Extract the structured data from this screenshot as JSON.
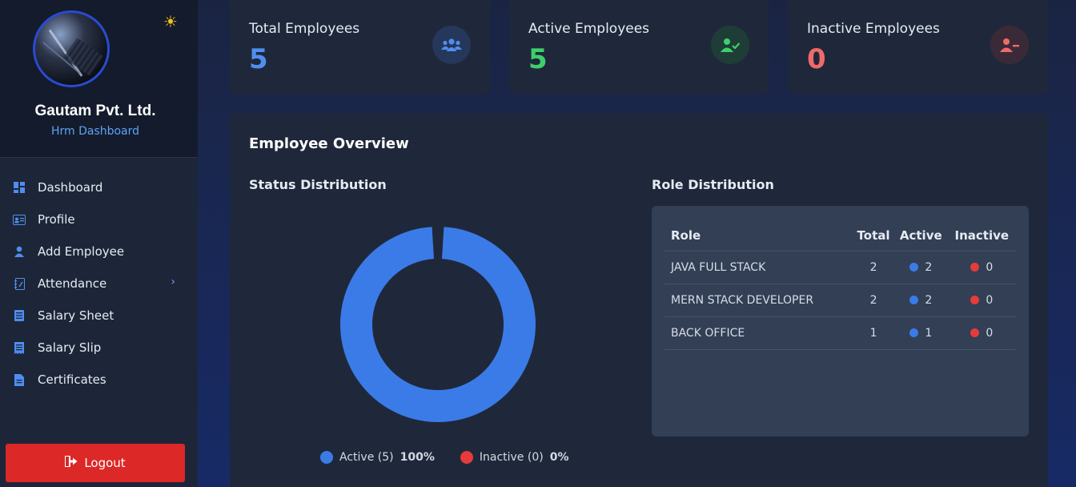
{
  "sidebar": {
    "company": "Gautam Pvt. Ltd.",
    "subtitle": "Hrm Dashboard",
    "theme_icon": "sun-icon",
    "items": [
      {
        "label": "Dashboard",
        "icon": "dashboard-icon"
      },
      {
        "label": "Profile",
        "icon": "id-card-icon"
      },
      {
        "label": "Add Employee",
        "icon": "user-icon"
      },
      {
        "label": "Attendance",
        "icon": "notebook-icon",
        "has_submenu": true
      },
      {
        "label": "Salary Sheet",
        "icon": "list-icon"
      },
      {
        "label": "Salary Slip",
        "icon": "receipt-icon"
      },
      {
        "label": "Certificates",
        "icon": "file-icon"
      }
    ],
    "logout_label": "Logout"
  },
  "stats": [
    {
      "title": "Total Employees",
      "value": "5",
      "color": "#4f8ef0",
      "icon": "users-icon"
    },
    {
      "title": "Active Employees",
      "value": "5",
      "color": "#3ecf6b",
      "icon": "user-check-icon"
    },
    {
      "title": "Inactive Employees",
      "value": "0",
      "color": "#f06a6a",
      "icon": "user-minus-icon"
    }
  ],
  "overview": {
    "title": "Employee Overview",
    "status_title": "Status Distribution",
    "role_title": "Role Distribution",
    "legend": [
      {
        "label": "Active (5)",
        "pct": "100%",
        "color": "#3b7be8"
      },
      {
        "label": "Inactive (0)",
        "pct": "0%",
        "color": "#e53b3b"
      }
    ],
    "table": {
      "headers": [
        "Role",
        "Total",
        "Active",
        "Inactive"
      ],
      "rows": [
        {
          "role": "JAVA FULL STACK",
          "total": "2",
          "active": "2",
          "inactive": "0"
        },
        {
          "role": "MERN STACK DEVELOPER",
          "total": "2",
          "active": "2",
          "inactive": "0"
        },
        {
          "role": "BACK OFFICE",
          "total": "1",
          "active": "1",
          "inactive": "0"
        }
      ]
    }
  },
  "chart_data": {
    "type": "pie",
    "categories": [
      "Active",
      "Inactive"
    ],
    "values": [
      5,
      0
    ],
    "colors": [
      "#3b7be8",
      "#e53b3b"
    ],
    "title": "Status Distribution"
  }
}
